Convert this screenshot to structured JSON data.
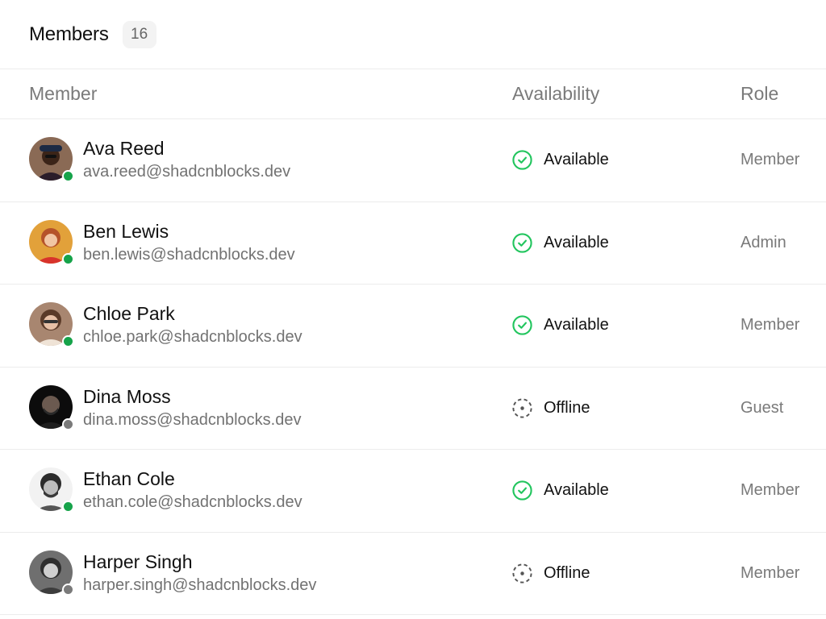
{
  "header": {
    "title": "Members",
    "count": "16"
  },
  "columns": {
    "member": "Member",
    "availability": "Availability",
    "role": "Role"
  },
  "colors": {
    "available": "#22c55e",
    "online_dot": "#16a34a",
    "offline_dot": "#7a7a7a",
    "offline_icon": "#555555"
  },
  "members": [
    {
      "name": "Ava Reed",
      "email": "ava.reed@shadcnblocks.dev",
      "status": "Available",
      "presence": "online",
      "role": "Member"
    },
    {
      "name": "Ben Lewis",
      "email": "ben.lewis@shadcnblocks.dev",
      "status": "Available",
      "presence": "online",
      "role": "Admin"
    },
    {
      "name": "Chloe Park",
      "email": "chloe.park@shadcnblocks.dev",
      "status": "Available",
      "presence": "online",
      "role": "Member"
    },
    {
      "name": "Dina Moss",
      "email": "dina.moss@shadcnblocks.dev",
      "status": "Offline",
      "presence": "offline",
      "role": "Guest"
    },
    {
      "name": "Ethan Cole",
      "email": "ethan.cole@shadcnblocks.dev",
      "status": "Available",
      "presence": "online",
      "role": "Member"
    },
    {
      "name": "Harper Singh",
      "email": "harper.singh@shadcnblocks.dev",
      "status": "Offline",
      "presence": "offline",
      "role": "Member"
    }
  ]
}
